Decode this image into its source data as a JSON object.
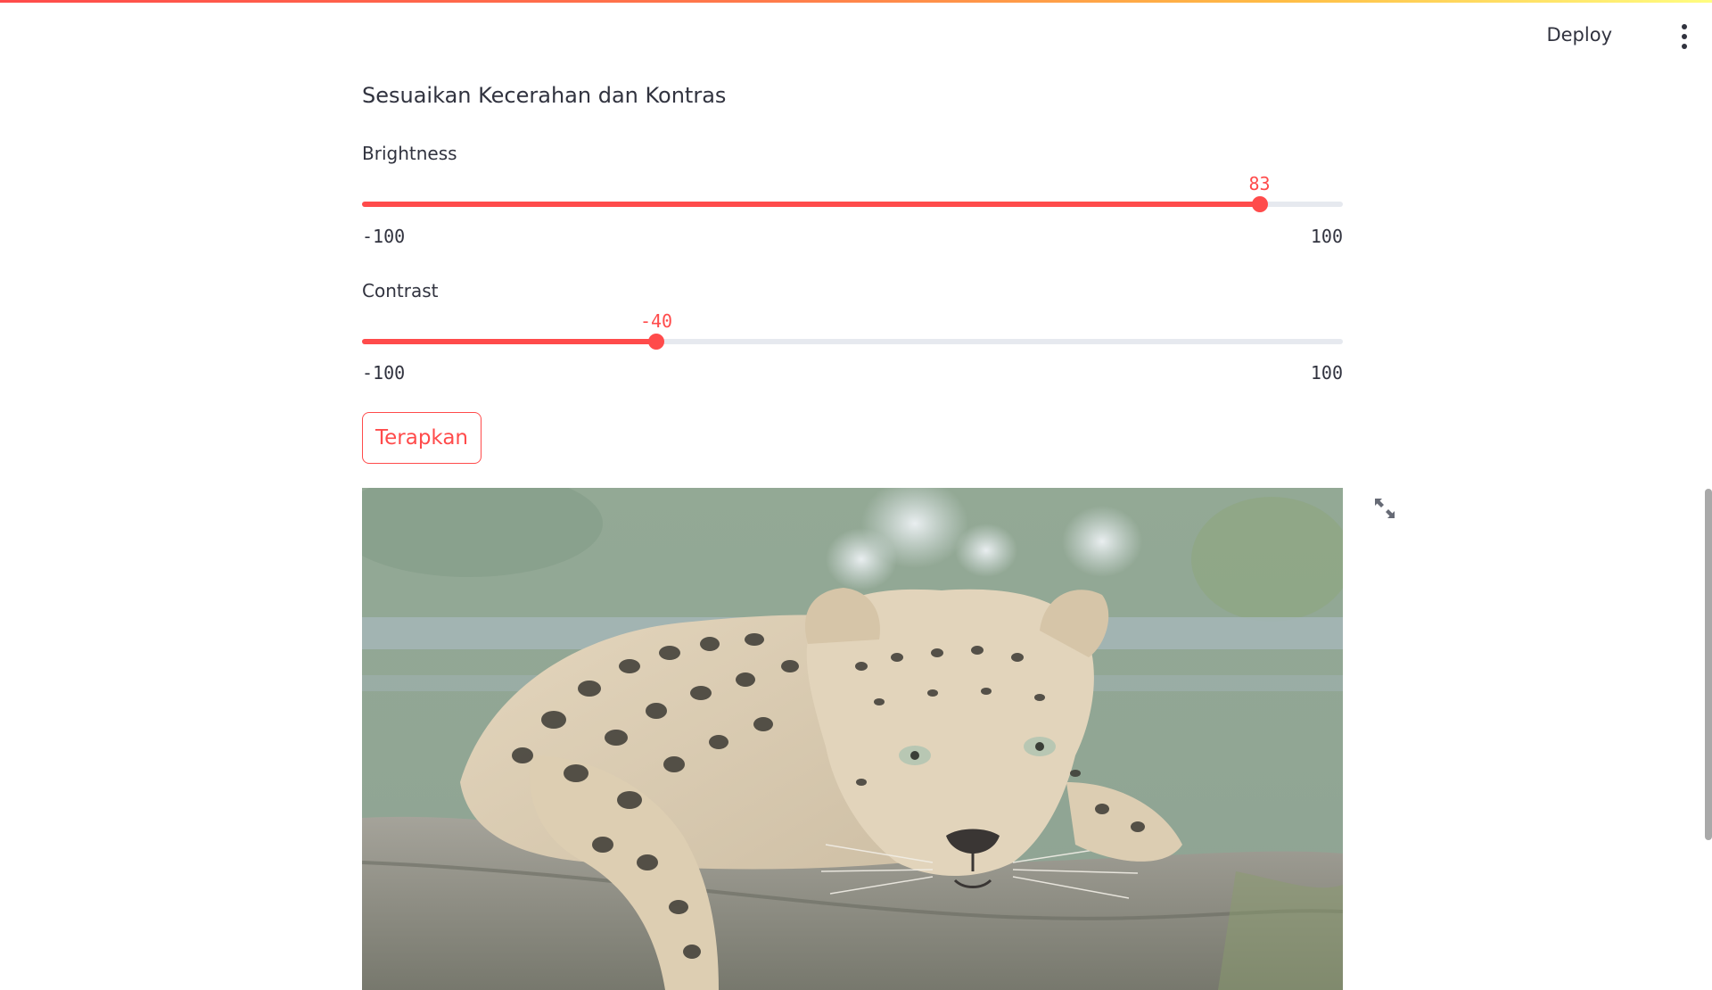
{
  "header": {
    "deploy_label": "Deploy",
    "menu_icon": "more-vertical-icon"
  },
  "section_title": "Sesuaikan Kecerahan dan Kontras",
  "brightness": {
    "label": "Brightness",
    "value": 83,
    "value_text": "83",
    "min": -100,
    "max": 100,
    "min_text": "-100",
    "max_text": "100"
  },
  "contrast": {
    "label": "Contrast",
    "value": -40,
    "value_text": "-40",
    "min": -100,
    "max": 100,
    "min_text": "-100",
    "max_text": "100"
  },
  "apply_button_label": "Terapkan",
  "image": {
    "subject": "leopard-resting-on-log",
    "fullscreen_icon": "expand-icon"
  },
  "colors": {
    "accent": "#ff4b4b",
    "text": "#31333f",
    "track": "#e6e9ef"
  }
}
